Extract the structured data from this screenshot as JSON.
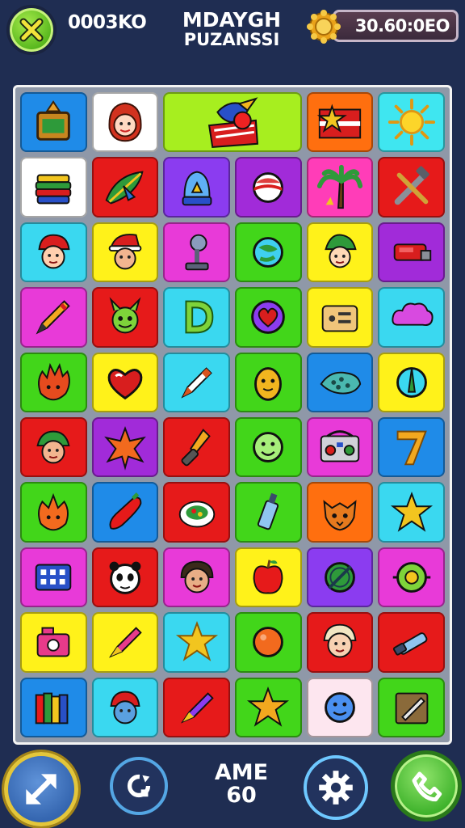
{
  "header": {
    "score": "0003KO",
    "title_line1": "MDAYGH",
    "title_line2": "PUZANSSI",
    "coins": "30.60:0EO",
    "close_icon": "close-x-icon",
    "coin_icon": "gold-coin-icon"
  },
  "board": {
    "rows": [
      [
        {
          "icon": "bread-plate-icon",
          "bg": "#1f8be8"
        },
        {
          "icon": "red-haired-girl-icon",
          "bg": "#ffffff"
        },
        {
          "icon": "parrot-flag-icon",
          "bg": "#a7ee1f",
          "wide": true
        },
        {
          "icon": "star-flag-icon",
          "bg": "#ff6f0f"
        },
        {
          "icon": "sun-icon",
          "bg": "#3fe6f0"
        }
      ],
      [
        {
          "icon": "layered-cake-icon",
          "bg": "#ffffff"
        },
        {
          "icon": "leaf-bird-icon",
          "bg": "#e61a1a"
        },
        {
          "icon": "snow-globe-icon",
          "bg": "#8b3cf0"
        },
        {
          "icon": "candy-ball-icon",
          "bg": "#a12bd9"
        },
        {
          "icon": "palm-tree-icon",
          "bg": "#ff3db8"
        },
        {
          "icon": "crossed-tools-icon",
          "bg": "#e61a1a"
        }
      ],
      [
        {
          "icon": "red-hat-boy-icon",
          "bg": "#3ad8f0"
        },
        {
          "icon": "santa-face-icon",
          "bg": "#fff21a"
        },
        {
          "icon": "desk-lamp-icon",
          "bg": "#e83ad8"
        },
        {
          "icon": "planet-icon",
          "bg": "#42d61a"
        },
        {
          "icon": "green-elf-icon",
          "bg": "#fff21a"
        },
        {
          "icon": "red-tool-icon",
          "bg": "#a12bd9"
        }
      ],
      [
        {
          "icon": "pencil-icon",
          "bg": "#e83ad8"
        },
        {
          "icon": "green-monster-icon",
          "bg": "#e61a1a"
        },
        {
          "icon": "letter-d-icon",
          "bg": "#3ad8f0"
        },
        {
          "icon": "heart-badge-icon",
          "bg": "#42d61a"
        },
        {
          "icon": "radio-box-icon",
          "bg": "#fff21a"
        },
        {
          "icon": "pink-cloud-icon",
          "bg": "#3ad8f0"
        }
      ],
      [
        {
          "icon": "fire-imp-icon",
          "bg": "#42d61a"
        },
        {
          "icon": "red-heart-icon",
          "bg": "#fff21a"
        },
        {
          "icon": "crayon-icon",
          "bg": "#3ad8f0"
        },
        {
          "icon": "golden-egg-icon",
          "bg": "#42d61a"
        },
        {
          "icon": "spotted-fish-icon",
          "bg": "#1f8be8"
        },
        {
          "icon": "green-feather-icon",
          "bg": "#fff21a"
        }
      ],
      [
        {
          "icon": "elf-face-icon",
          "bg": "#e61a1a"
        },
        {
          "icon": "orange-leaf-icon",
          "bg": "#a12bd9"
        },
        {
          "icon": "torch-icon",
          "bg": "#e61a1a"
        },
        {
          "icon": "smiley-face-icon",
          "bg": "#42d61a"
        },
        {
          "icon": "boombox-icon",
          "bg": "#e83ad8"
        },
        {
          "icon": "number-seven-icon",
          "bg": "#1f8be8"
        }
      ],
      [
        {
          "icon": "orange-monster-icon",
          "bg": "#42d61a"
        },
        {
          "icon": "chili-pepper-icon",
          "bg": "#1f8be8"
        },
        {
          "icon": "salad-plate-icon",
          "bg": "#e61a1a"
        },
        {
          "icon": "glue-tube-icon",
          "bg": "#42d61a"
        },
        {
          "icon": "fox-face-icon",
          "bg": "#ff6f0f"
        },
        {
          "icon": "yellow-star-icon",
          "bg": "#3ad8f0"
        }
      ],
      [
        {
          "icon": "keypad-icon",
          "bg": "#e83ad8"
        },
        {
          "icon": "panda-icon",
          "bg": "#e61a1a"
        },
        {
          "icon": "boy-face-icon",
          "bg": "#e83ad8"
        },
        {
          "icon": "apple-icon",
          "bg": "#fff21a"
        },
        {
          "icon": "leaf-coin-icon",
          "bg": "#8b3cf0"
        },
        {
          "icon": "turtle-shell-icon",
          "bg": "#e83ad8"
        }
      ],
      [
        {
          "icon": "pink-camera-icon",
          "bg": "#fff21a"
        },
        {
          "icon": "marker-icon",
          "bg": "#fff21a"
        },
        {
          "icon": "gold-star-icon",
          "bg": "#3ad8f0"
        },
        {
          "icon": "orange-ball-icon",
          "bg": "#42d61a"
        },
        {
          "icon": "cherub-face-icon",
          "bg": "#e61a1a"
        },
        {
          "icon": "telescope-icon",
          "bg": "#e61a1a"
        }
      ],
      [
        {
          "icon": "books-icon",
          "bg": "#1f8be8"
        },
        {
          "icon": "cap-boy-icon",
          "bg": "#3ad8f0"
        },
        {
          "icon": "paint-pen-icon",
          "bg": "#e61a1a"
        },
        {
          "icon": "green-star-icon",
          "bg": "#42d61a"
        },
        {
          "icon": "blue-smiley-icon",
          "bg": "#fde6ef"
        },
        {
          "icon": "writing-pad-icon",
          "bg": "#42d61a"
        }
      ]
    ]
  },
  "footer": {
    "game_label_line1": "AME",
    "game_label_line2": "60",
    "expand_icon": "expand-arrows-icon",
    "refresh_icon": "refresh-gear-icon",
    "settings_icon": "settings-gear-icon",
    "phone_icon": "phone-icon"
  }
}
